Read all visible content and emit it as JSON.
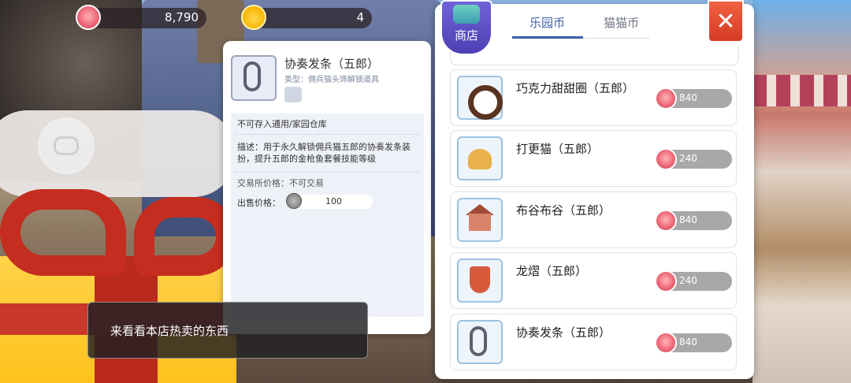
{
  "hud": {
    "currency_pig": {
      "icon": "pig-coin-icon",
      "value": "8,790"
    },
    "currency_paw": {
      "icon": "paw-coin-icon",
      "value": "4"
    }
  },
  "tooltip": {
    "title": "协奏发条（五郎）",
    "type": "类型：佣兵猫头饰解锁道具",
    "note": "不可存入通用/家园仓库",
    "description": "描述：用于永久解锁佣兵猫五郎的协奏发条装扮，提升五郎的金枪鱼套餐技能等级",
    "trade": "交易所价格：不可交易",
    "sell_label": "出售价格：",
    "sell_value": "100"
  },
  "chat": {
    "text": "来看看本店热卖的东西"
  },
  "shop": {
    "badge": "商店",
    "tabs": [
      {
        "label": "乐园币",
        "active": true
      },
      {
        "label": "猫猫币",
        "active": false
      }
    ],
    "close": "✕",
    "items": [
      {
        "name": "巧克力甜甜圈（五郎）",
        "price": "840",
        "icon": "donut-icon"
      },
      {
        "name": "打更猫（五郎）",
        "price": "240",
        "icon": "bell-cat-icon"
      },
      {
        "name": "布谷布谷（五郎）",
        "price": "840",
        "icon": "cuckoo-house-icon"
      },
      {
        "name": "龙熠（五郎）",
        "price": "240",
        "icon": "dragon-shield-icon"
      },
      {
        "name": "协奏发条（五郎）",
        "price": "840",
        "icon": "wind-up-key-icon"
      }
    ]
  },
  "colors": {
    "accent": "#3c5ea8",
    "close": "#e04b30",
    "price_pill": "#a8a8a8"
  }
}
